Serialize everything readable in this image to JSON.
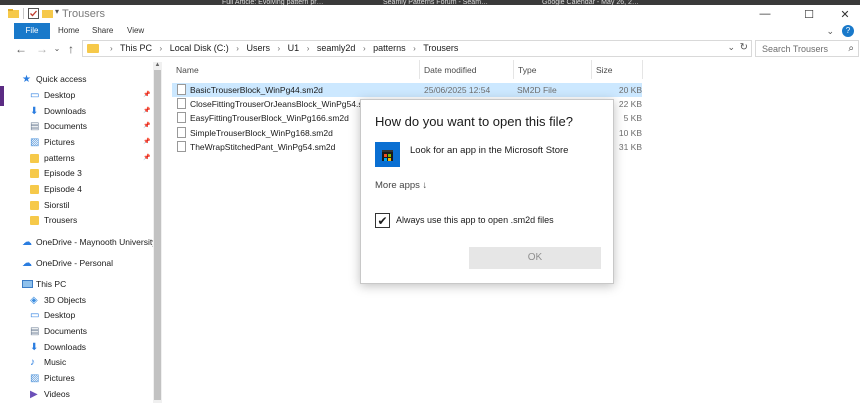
{
  "background_apps": {
    "tabs": [
      "Full Article: Evolving pattern pr…",
      "Seamly Patterns Forum - Seam…",
      "Google Calendar - May 26, 2…"
    ]
  },
  "window": {
    "title": "Trousers",
    "controls": {
      "minimize": "—",
      "maximize": "☐",
      "close": "✕"
    }
  },
  "ribbon": {
    "tabs": [
      "File",
      "Home",
      "Share",
      "View"
    ]
  },
  "address_bar": {
    "breadcrumbs": [
      "This PC",
      "Local Disk (C:)",
      "Users",
      "U1",
      "seamly2d",
      "patterns",
      "Trousers"
    ],
    "search_placeholder": "Search Trousers"
  },
  "sidebar": {
    "items": [
      {
        "label": "Quick access",
        "icon": "star-icon",
        "indent": 0,
        "pinned": false
      },
      {
        "label": "Desktop",
        "icon": "desktop-icon",
        "indent": 1,
        "pinned": true
      },
      {
        "label": "Downloads",
        "icon": "download-icon",
        "indent": 1,
        "pinned": true
      },
      {
        "label": "Documents",
        "icon": "documents-icon",
        "indent": 1,
        "pinned": true
      },
      {
        "label": "Pictures",
        "icon": "pictures-icon",
        "indent": 1,
        "pinned": true
      },
      {
        "label": "patterns",
        "icon": "folder-icon",
        "indent": 1,
        "pinned": true
      },
      {
        "label": "Episode 3",
        "icon": "folder-icon",
        "indent": 1,
        "pinned": false
      },
      {
        "label": "Episode 4",
        "icon": "folder-icon",
        "indent": 1,
        "pinned": false
      },
      {
        "label": "Siorstil",
        "icon": "folder-icon",
        "indent": 1,
        "pinned": false
      },
      {
        "label": "Trousers",
        "icon": "folder-icon",
        "indent": 1,
        "pinned": false
      },
      {
        "label": "OneDrive - Maynooth University",
        "icon": "cloud-icon",
        "indent": 0,
        "pinned": false
      },
      {
        "label": "OneDrive - Personal",
        "icon": "cloud-icon",
        "indent": 0,
        "pinned": false
      },
      {
        "label": "This PC",
        "icon": "computer-icon",
        "indent": 0,
        "pinned": false
      },
      {
        "label": "3D Objects",
        "icon": "cube-icon",
        "indent": 1,
        "pinned": false
      },
      {
        "label": "Desktop",
        "icon": "desktop-icon",
        "indent": 1,
        "pinned": false
      },
      {
        "label": "Documents",
        "icon": "documents-icon",
        "indent": 1,
        "pinned": false
      },
      {
        "label": "Downloads",
        "icon": "download-icon",
        "indent": 1,
        "pinned": false
      },
      {
        "label": "Music",
        "icon": "music-icon",
        "indent": 1,
        "pinned": false
      },
      {
        "label": "Pictures",
        "icon": "pictures-icon",
        "indent": 1,
        "pinned": false
      },
      {
        "label": "Videos",
        "icon": "video-icon",
        "indent": 1,
        "pinned": false
      }
    ]
  },
  "file_list": {
    "columns": [
      "Name",
      "Date modified",
      "Type",
      "Size"
    ],
    "rows": [
      {
        "name": "BasicTrouserBlock_WinPg44.sm2d",
        "date": "25/06/2025 12:54",
        "type": "SM2D File",
        "size": "20 KB",
        "selected": true
      },
      {
        "name": "CloseFittingTrouserOrJeansBlock_WinPg54.sm2d",
        "date": "",
        "type": "",
        "size": "22 KB",
        "selected": false
      },
      {
        "name": "EasyFittingTrouserBlock_WinPg166.sm2d",
        "date": "",
        "type": "",
        "size": "5 KB",
        "selected": false
      },
      {
        "name": "SimpleTrouserBlock_WinPg168.sm2d",
        "date": "",
        "type": "",
        "size": "10 KB",
        "selected": false
      },
      {
        "name": "TheWrapStitchedPant_WinPg54.sm2d",
        "date": "",
        "type": "",
        "size": "31 KB",
        "selected": false
      }
    ]
  },
  "dialog": {
    "title": "How do you want to open this file?",
    "store_option": "Look for an app in the Microsoft Store",
    "more_apps": "More apps ↓",
    "always_use_label": "Always use this app to open .sm2d files",
    "always_use_checked": true,
    "ok_label": "OK"
  },
  "colors": {
    "accent": "#1979ca",
    "selection": "#cce8ff",
    "folder": "#f6c94a",
    "store_tile": "#0a6fd2"
  }
}
